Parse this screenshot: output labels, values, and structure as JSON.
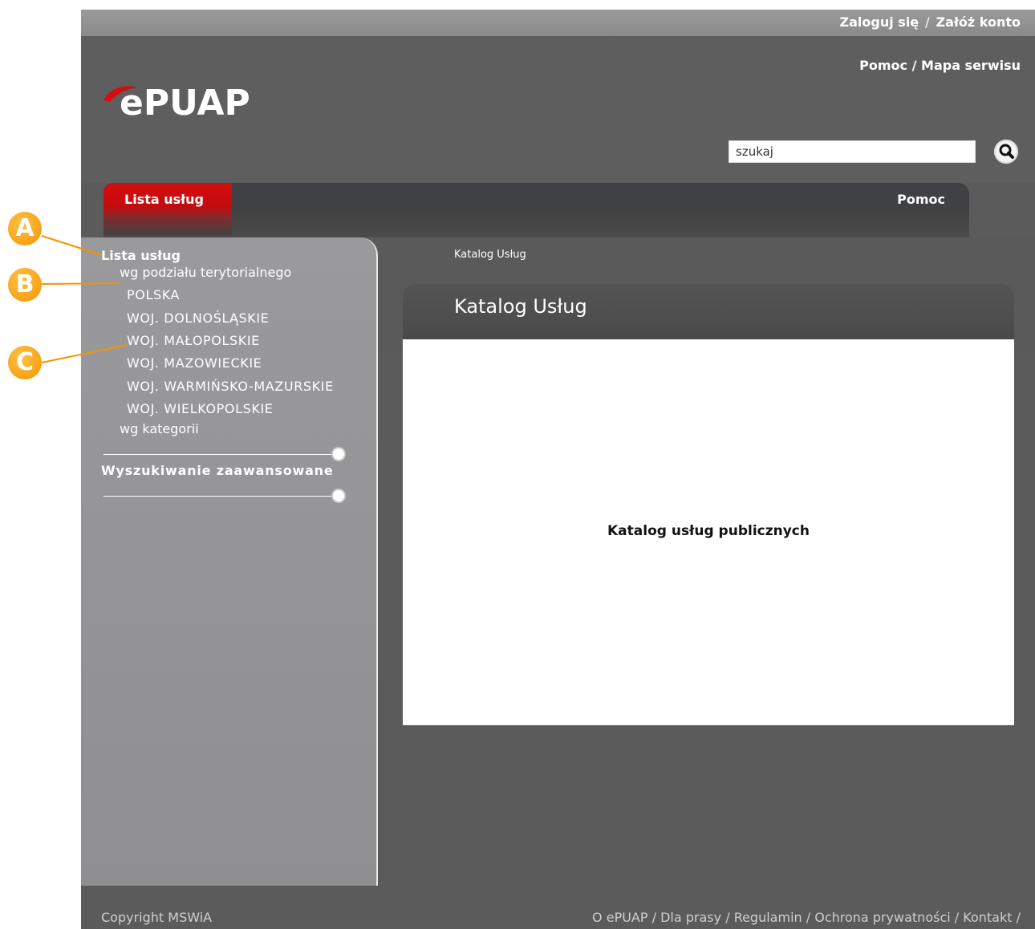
{
  "topbar": {
    "login": "Zaloguj się",
    "separator": "/",
    "register": "Załóż konto"
  },
  "header": {
    "help": "Pomoc",
    "sep": "/",
    "sitemap": "Mapa serwisu",
    "logo_text": "ePUAP",
    "search": {
      "value": "szukaj"
    }
  },
  "nav": {
    "tab_active": "Lista usług",
    "tab_help": "Pomoc"
  },
  "sidebar": {
    "title": "Lista usług",
    "territorial": "wg podziału terytorialnego",
    "regions": [
      "POLSKA",
      "WOJ. DOLNOŚLĄSKIE",
      "WOJ. MAŁOPOLSKIE",
      "WOJ. MAZOWIECKIE",
      "WOJ. WARMIŃSKO-MAZURSKIE",
      "WOJ. WIELKOPOLSKIE"
    ],
    "category": "wg kategorii",
    "advanced": "Wyszukiwanie zaawansowane"
  },
  "main": {
    "breadcrumb": "Katalog Usług",
    "panel_title": "Katalog Usług",
    "panel_text": "Katalog usług publicznych"
  },
  "footer": {
    "copyright": "Copyright MSWiA",
    "links": [
      "O ePUAP",
      "Dla prasy",
      "Regulamin",
      "Ochrona prywatności",
      "Kontakt"
    ],
    "sep": "/"
  },
  "callouts": [
    "A",
    "B",
    "C"
  ],
  "colors": {
    "brand_red": "#d30d10",
    "callout_orange": "#f49400"
  }
}
